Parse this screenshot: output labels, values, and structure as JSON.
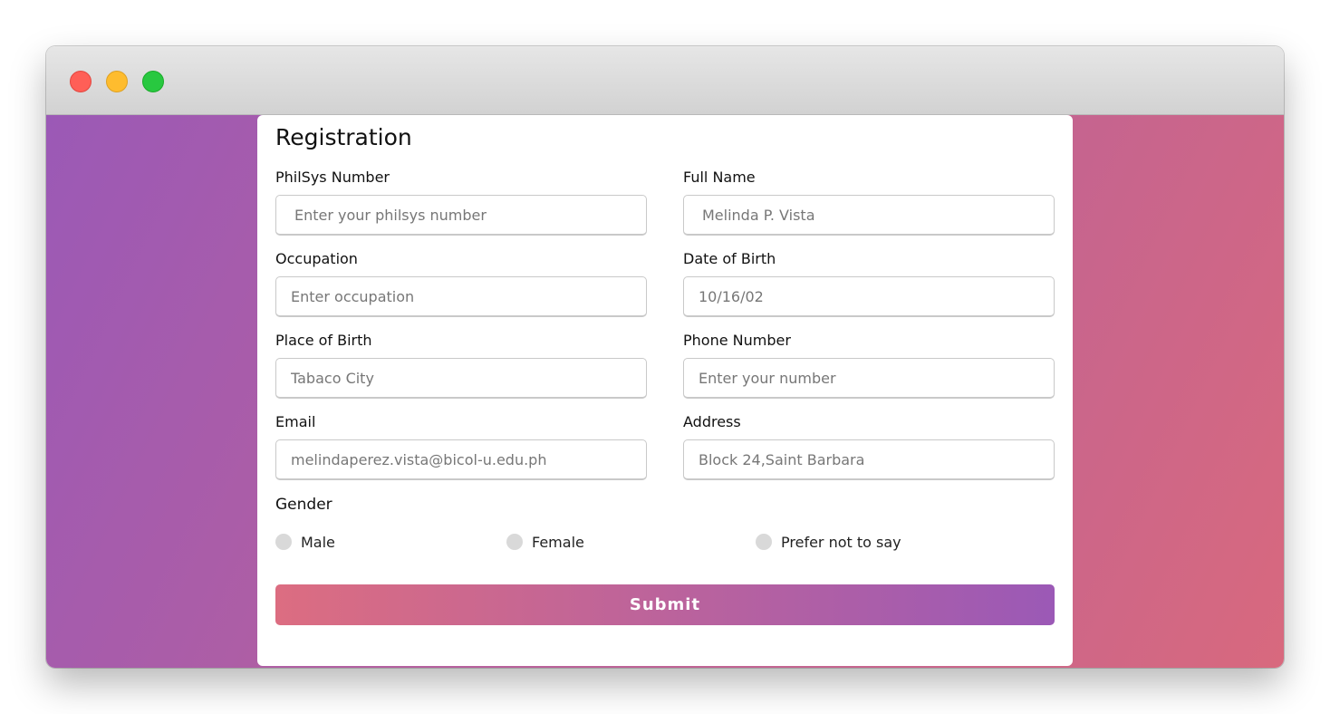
{
  "window": {
    "controls": [
      "close",
      "minimize",
      "maximize"
    ],
    "colors": {
      "close": "#ff5f57",
      "minimize": "#febc2e",
      "maximize": "#28c840"
    }
  },
  "background": {
    "gradient_start": "#9b59b6",
    "gradient_end": "#d8697e"
  },
  "form": {
    "title": "Registration",
    "fields": {
      "philsys": {
        "label": "PhilSys Number",
        "placeholder": "Enter your philsys number",
        "value": ""
      },
      "full_name": {
        "label": "Full Name",
        "placeholder": "Melinda P. Vista",
        "value": ""
      },
      "occupation": {
        "label": "Occupation",
        "placeholder": "Enter occupation",
        "value": ""
      },
      "dob": {
        "label": "Date of Birth",
        "placeholder": "10/16/02",
        "value": ""
      },
      "pob": {
        "label": "Place of Birth",
        "placeholder": "Tabaco City",
        "value": ""
      },
      "phone": {
        "label": "Phone Number",
        "placeholder": "Enter your number",
        "value": ""
      },
      "email": {
        "label": "Email",
        "placeholder": "melindaperez.vista@bicol-u.edu.ph",
        "value": ""
      },
      "address": {
        "label": "Address",
        "placeholder": "Block 24,Saint Barbara",
        "value": ""
      }
    },
    "gender": {
      "title": "Gender",
      "options": [
        "Male",
        "Female",
        "Prefer not to say"
      ]
    },
    "submit_label": "Submit"
  }
}
